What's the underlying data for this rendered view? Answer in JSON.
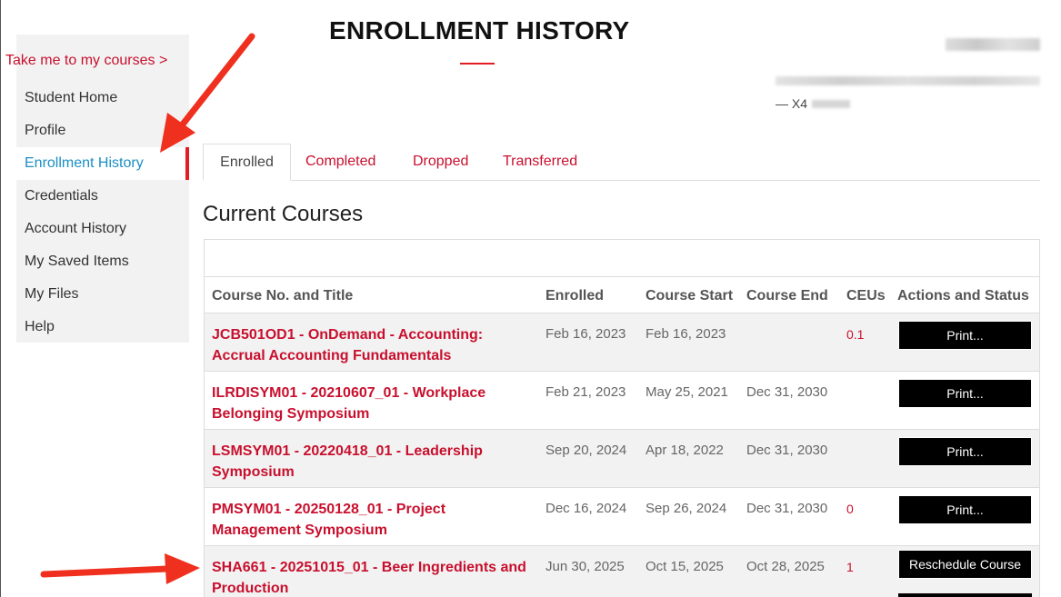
{
  "sidebar": {
    "take_me": "Take me to my courses >",
    "items": [
      {
        "label": "Student Home"
      },
      {
        "label": "Profile"
      },
      {
        "label": "Enrollment History"
      },
      {
        "label": "Credentials"
      },
      {
        "label": "Account History"
      },
      {
        "label": "My Saved Items"
      },
      {
        "label": "My Files"
      },
      {
        "label": "Help"
      }
    ]
  },
  "header": {
    "title": "ENROLLMENT HISTORY",
    "user_id_prefix": "— X4"
  },
  "tabs": [
    {
      "label": "Enrolled"
    },
    {
      "label": "Completed"
    },
    {
      "label": "Dropped"
    },
    {
      "label": "Transferred"
    }
  ],
  "section_title": "Current Courses",
  "table": {
    "headers": [
      "Course No. and Title",
      "Enrolled",
      "Course Start",
      "Course End",
      "CEUs",
      "Actions and Status"
    ],
    "rows": [
      {
        "title": "JCB501OD1 - OnDemand - Accounting: Accrual Accounting Fundamentals",
        "enrolled": "Feb 16, 2023",
        "start": "Feb 16, 2023",
        "end": "",
        "ceus": "0.1",
        "action": "Print..."
      },
      {
        "title": "ILRDISYM01 - 20210607_01 - Workplace Belonging Symposium",
        "enrolled": "Feb 21, 2023",
        "start": "May 25, 2021",
        "end": "Dec 31, 2030",
        "ceus": "",
        "action": "Print..."
      },
      {
        "title": "LSMSYM01 - 20220418_01 - Leadership Symposium",
        "enrolled": "Sep 20, 2024",
        "start": "Apr 18, 2022",
        "end": "Dec 31, 2030",
        "ceus": "",
        "action": "Print..."
      },
      {
        "title": "PMSYM01 - 20250128_01 - Project Management Symposium",
        "enrolled": "Dec 16, 2024",
        "start": "Sep 26, 2024",
        "end": "Dec 31, 2030",
        "ceus": "0",
        "action": "Print..."
      },
      {
        "title": "SHA661 - 20251015_01 - Beer Ingredients and Production",
        "enrolled": "Jun 30, 2025",
        "start": "Oct 15, 2025",
        "end": "Oct 28, 2025",
        "ceus": "1",
        "action": "Reschedule Course"
      }
    ]
  },
  "colors": {
    "brand_red": "#c8102e",
    "active_link": "#1a8fc4",
    "arrow": "#f0301f"
  }
}
